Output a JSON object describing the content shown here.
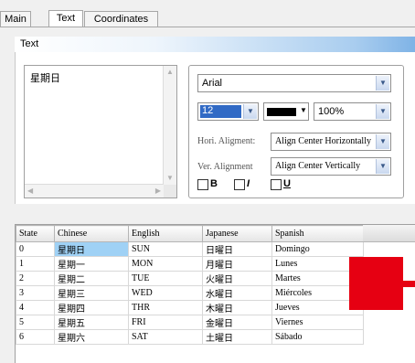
{
  "tabs": [
    "Main",
    "Text",
    "Coordinates"
  ],
  "active_tab": "Text",
  "text_group": {
    "title": "Text",
    "content": "星期日"
  },
  "font": {
    "family": "Arial",
    "size": "12",
    "color": "#000000",
    "opacity": "100%",
    "hori_label": "Hori. Aligment:",
    "hori_value": "Align Center Horizontally",
    "vert_label": "Ver. Alignment",
    "vert_value": "Align Center Vertically",
    "bold_label": "B",
    "italic_label": "I",
    "underline_label": "U"
  },
  "table": {
    "headers": [
      "State",
      "Chinese",
      "English",
      "Japanese",
      "Spanish"
    ],
    "rows": [
      [
        "0",
        "星期日",
        "SUN",
        "日曜日",
        "Domingo"
      ],
      [
        "1",
        "星期一",
        "MON",
        "月曜日",
        "Lunes"
      ],
      [
        "2",
        "星期二",
        "TUE",
        "火曜日",
        "Martes"
      ],
      [
        "3",
        "星期三",
        "WED",
        "水曜日",
        "Miércoles"
      ],
      [
        "4",
        "星期四",
        "THR",
        "木曜日",
        "Jueves"
      ],
      [
        "5",
        "星期五",
        "FRI",
        "金曜日",
        "Viernes"
      ],
      [
        "6",
        "星期六",
        "SAT",
        "土曜日",
        "Sábado"
      ]
    ],
    "selected_cell": [
      0,
      1
    ]
  },
  "colors": {
    "accent_red": "#e60012",
    "selection_blue": "#316ac5",
    "cell_highlight": "#9fd1f5"
  }
}
